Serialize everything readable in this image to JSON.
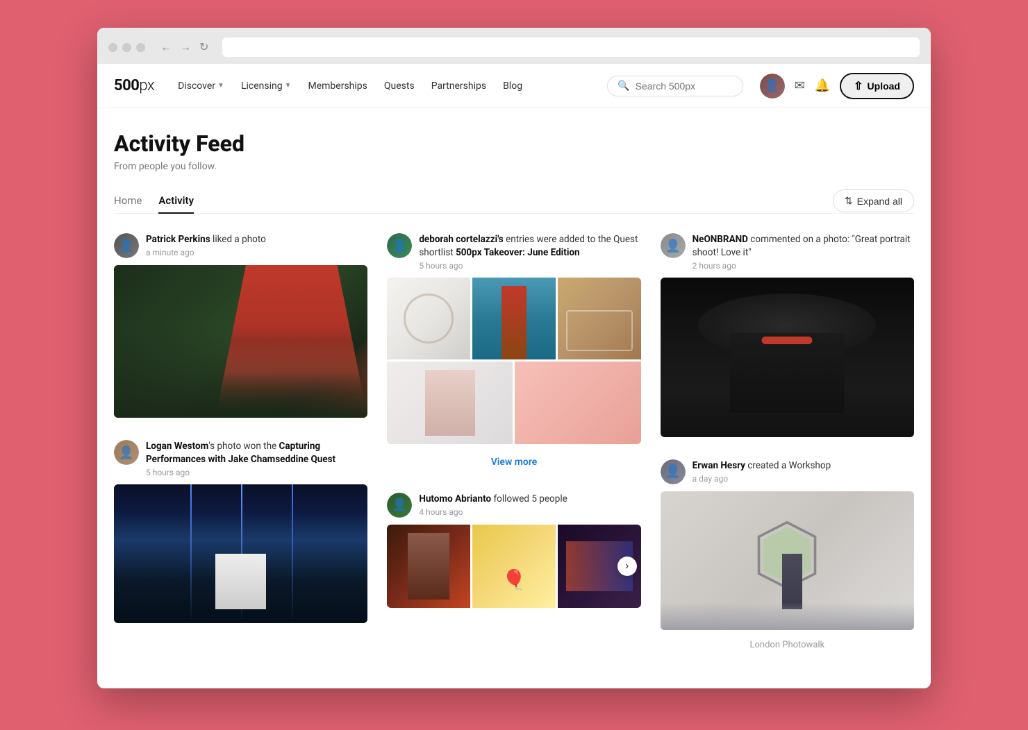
{
  "browser": {
    "dots": [
      "red",
      "yellow",
      "green"
    ]
  },
  "navbar": {
    "logo": "500px",
    "nav_links": [
      {
        "label": "Discover",
        "has_dropdown": true
      },
      {
        "label": "Licensing",
        "has_dropdown": true
      },
      {
        "label": "Memberships",
        "has_dropdown": false
      },
      {
        "label": "Quests",
        "has_dropdown": false
      },
      {
        "label": "Partnerships",
        "has_dropdown": false
      },
      {
        "label": "Blog",
        "has_dropdown": false
      }
    ],
    "search_placeholder": "Search 500px",
    "upload_label": "Upload"
  },
  "page": {
    "title": "Activity Feed",
    "subtitle": "From people you follow.",
    "tabs": [
      {
        "label": "Home",
        "active": false
      },
      {
        "label": "Activity",
        "active": true
      }
    ],
    "expand_all_label": "Expand all"
  },
  "feed": {
    "items": [
      {
        "id": "patrick",
        "user": "Patrick Perkins",
        "action": " liked a photo",
        "time": "a minute ago",
        "type": "photo"
      },
      {
        "id": "deborah",
        "user": "deborah cortelazzi's",
        "action": " entries were added to the Quest shortlist ",
        "action_bold": "500px Takeover: June Edition",
        "time": "5 hours ago",
        "type": "quest_photos",
        "view_more": "View more"
      },
      {
        "id": "neon",
        "user": "NeONBRAND",
        "action": " commented on a photo: \"Great portrait shoot! Love it\"",
        "time": "2 hours ago",
        "type": "photo"
      },
      {
        "id": "logan",
        "user": "Logan Westom",
        "action": "'s photo won the ",
        "action_bold": "Capturing Performances with Jake Chamseddine Quest",
        "time": "5 hours ago",
        "type": "photo"
      },
      {
        "id": "hutomo",
        "user": "Hutomo Abrianto",
        "action": " followed 5 people",
        "time": "4 hours ago",
        "type": "follow"
      },
      {
        "id": "erwan",
        "user": "Erwan Hesry",
        "action": " created a Workshop",
        "time": "a day ago",
        "workshop_title": "London Photowalk",
        "type": "workshop"
      }
    ]
  }
}
